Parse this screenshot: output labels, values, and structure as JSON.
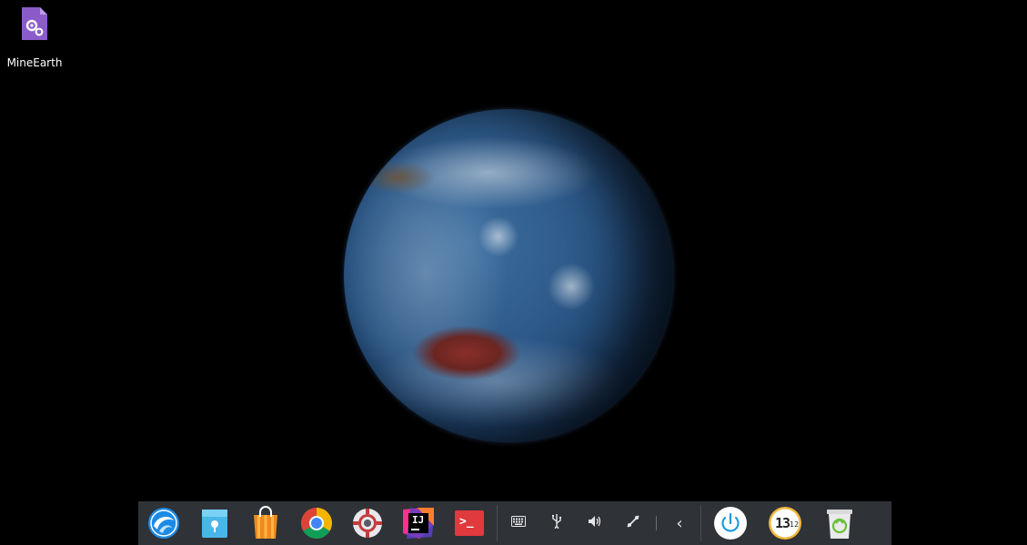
{
  "desktop": {
    "icons": [
      {
        "label": "MineEarth",
        "icon": "settings-file-icon",
        "color": "#8b5cc9"
      }
    ]
  },
  "wallpaper": {
    "subject": "earth-globe-icon"
  },
  "dock": {
    "apps": [
      {
        "name": "launcher",
        "icon": "deepin-launcher-icon"
      },
      {
        "name": "file-manager",
        "icon": "folder-icon"
      },
      {
        "name": "app-store",
        "icon": "store-bag-icon"
      },
      {
        "name": "chrome",
        "icon": "chrome-icon"
      },
      {
        "name": "settings",
        "icon": "gear-icon"
      },
      {
        "name": "intellij",
        "icon": "intellij-icon",
        "text": "IJ"
      },
      {
        "name": "terminal",
        "icon": "terminal-icon",
        "text": ">_"
      }
    ],
    "tray": [
      {
        "name": "keyboard",
        "icon": "keyboard-icon"
      },
      {
        "name": "usb",
        "icon": "usb-icon"
      },
      {
        "name": "volume",
        "icon": "volume-icon"
      },
      {
        "name": "network",
        "icon": "network-icon"
      },
      {
        "name": "collapse",
        "icon": "chevron-left-icon",
        "glyph": "‹"
      }
    ],
    "system": [
      {
        "name": "shutdown",
        "icon": "power-icon"
      },
      {
        "name": "clock",
        "icon": "clock-icon",
        "hour": "13",
        "minute": "12"
      },
      {
        "name": "trash",
        "icon": "trash-icon"
      }
    ]
  }
}
